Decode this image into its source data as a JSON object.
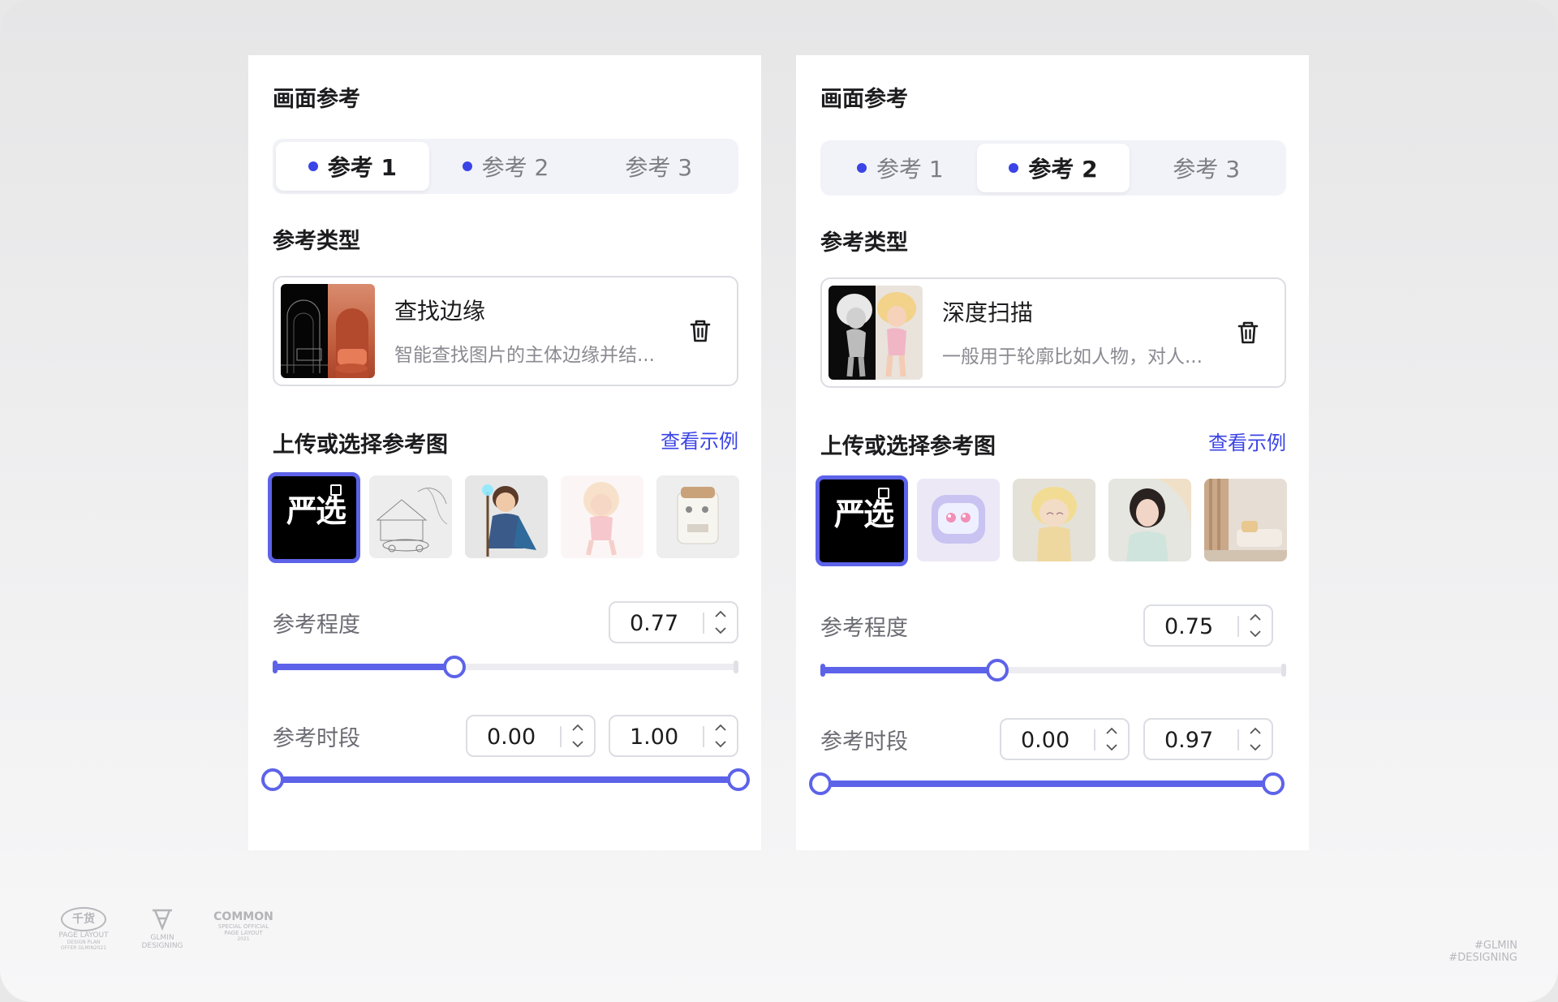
{
  "panels": [
    {
      "title": "画面参考",
      "tabs": [
        {
          "label": "参考 1",
          "dot": true,
          "active": true
        },
        {
          "label": "参考 2",
          "dot": true,
          "active": false
        },
        {
          "label": "参考 3",
          "dot": false,
          "active": false
        }
      ],
      "type_section_title": "参考类型",
      "type_card": {
        "name": "查找边缘",
        "desc": "智能查找图片的主体边缘并结..."
      },
      "upload_title": "上传或选择参考图",
      "example_link": "查看示例",
      "gallery": [
        "严选 logo",
        "sketch house",
        "cartoon boy",
        "fairy girl",
        "coffee machine"
      ],
      "degree_label": "参考程度",
      "degree_value": "0.77",
      "degree_fraction": 0.39,
      "period_label": "参考时段",
      "period_start": "0.00",
      "period_end": "1.00"
    },
    {
      "title": "画面参考",
      "tabs": [
        {
          "label": "参考 1",
          "dot": true,
          "active": false
        },
        {
          "label": "参考 2",
          "dot": true,
          "active": true
        },
        {
          "label": "参考 3",
          "dot": false,
          "active": false
        }
      ],
      "type_section_title": "参考类型",
      "type_card": {
        "name": "深度扫描",
        "desc": "一般用于轮廓比如人物，对人..."
      },
      "upload_title": "上传或选择参考图",
      "example_link": "查看示例",
      "gallery": [
        "严选 logo",
        "robot icon",
        "3d doll",
        "girl portrait",
        "living room"
      ],
      "degree_label": "参考程度",
      "degree_value": "0.75",
      "degree_fraction": 0.38,
      "period_label": "参考时段",
      "period_start": "0.00",
      "period_end": "0.97"
    }
  ],
  "logo_text": "严选",
  "footer": {
    "logo1_big": "千货",
    "logo1_line1": "PAGE LAYOUT",
    "logo1_line2": "DESIGN PLAN",
    "logo1_line3": "OFFER GLMIN2021",
    "logo2_line1": "GLMIN",
    "logo2_line2": "DESIGNING",
    "logo3_big": "COMMON",
    "logo3_line1": "SPECIAL OFFICIAL",
    "logo3_line2": "PAGE LAYOUT",
    "logo3_line3": "2021",
    "right_line1": "#GLMIN",
    "right_line2": "#DESIGNING"
  },
  "colors": {
    "accent": "#3b44e6",
    "slider": "#5d63e8",
    "panel": "#ffffff"
  }
}
